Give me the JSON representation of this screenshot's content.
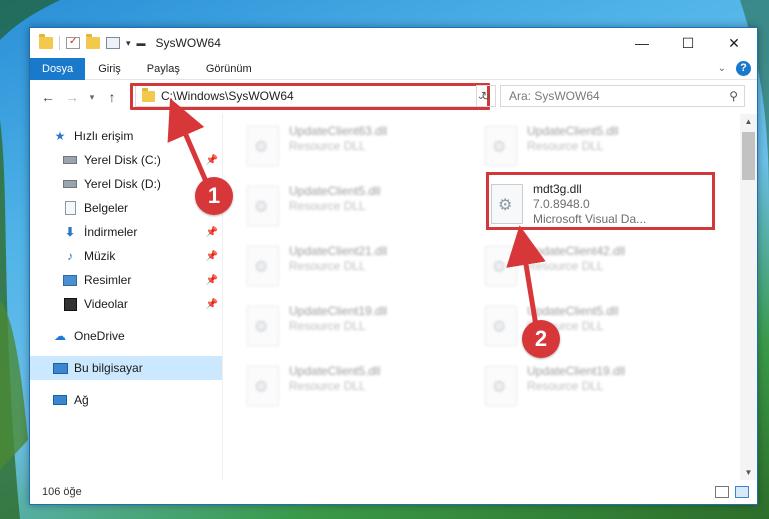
{
  "window": {
    "title": "SysWOW64",
    "controls": {
      "minimize": "—",
      "maximize": "☐",
      "close": "✕"
    }
  },
  "quick_access": {
    "icons": [
      "folder-icon",
      "properties-check-icon",
      "folder-icon",
      "properties-icon"
    ]
  },
  "ribbon": {
    "tabs": [
      {
        "label": "Dosya",
        "active": true
      },
      {
        "label": "Giriş"
      },
      {
        "label": "Paylaş"
      },
      {
        "label": "Görünüm"
      }
    ],
    "help": "?"
  },
  "navigation": {
    "path": "C:\\Windows\\SysWOW64",
    "search_placeholder": "Ara: SysWOW64"
  },
  "sidebar": {
    "items": [
      {
        "label": "Hızlı erişim",
        "icon": "star-icon"
      },
      {
        "label": "Yerel Disk (C:)",
        "icon": "drive-icon",
        "pinned": true
      },
      {
        "label": "Yerel Disk (D:)",
        "icon": "drive-icon"
      },
      {
        "label": "Belgeler",
        "icon": "documents-icon",
        "pinned": true
      },
      {
        "label": "İndirmeler",
        "icon": "downloads-icon",
        "pinned": true
      },
      {
        "label": "Müzik",
        "icon": "music-icon",
        "pinned": true
      },
      {
        "label": "Resimler",
        "icon": "pictures-icon",
        "pinned": true
      },
      {
        "label": "Videolar",
        "icon": "videos-icon",
        "pinned": true
      },
      {
        "label": "OneDrive",
        "icon": "onedrive-icon"
      },
      {
        "label": "Bu bilgisayar",
        "icon": "this-pc-icon",
        "selected": true
      },
      {
        "label": "Ağ",
        "icon": "network-icon"
      }
    ]
  },
  "files": [
    {
      "name": "UpdateClient63.dll",
      "line2": "Resource DLL",
      "line3": ""
    },
    {
      "name": "UpdateClient5.dll",
      "line2": "Resource DLL",
      "line3": ""
    },
    {
      "name": "UpdateClient5.dll",
      "line2": "Resource DLL",
      "line3": ""
    },
    {
      "name": "mdt3g.dll",
      "line2": "7.0.8948.0",
      "line3": "Microsoft Visual Da...",
      "highlighted": true
    },
    {
      "name": "UpdateClient21.dll",
      "line2": "Resource DLL",
      "line3": ""
    },
    {
      "name": "UpdateClient42.dll",
      "line2": "Resource DLL",
      "line3": ""
    },
    {
      "name": "UpdateClient19.dll",
      "line2": "Resource DLL",
      "line3": ""
    },
    {
      "name": "UpdateClient5.dll",
      "line2": "Resource DLL",
      "line3": ""
    },
    {
      "name": "UpdateClient5.dll",
      "line2": "Resource DLL",
      "line3": ""
    },
    {
      "name": "UpdateClient19.dll",
      "line2": "Resource DLL",
      "line3": ""
    }
  ],
  "status": {
    "count": "106 öğe"
  },
  "callouts": [
    "1",
    "2"
  ],
  "colors": {
    "accent": "#1979ca",
    "highlight": "#d4373a",
    "selection": "#cce8ff"
  }
}
